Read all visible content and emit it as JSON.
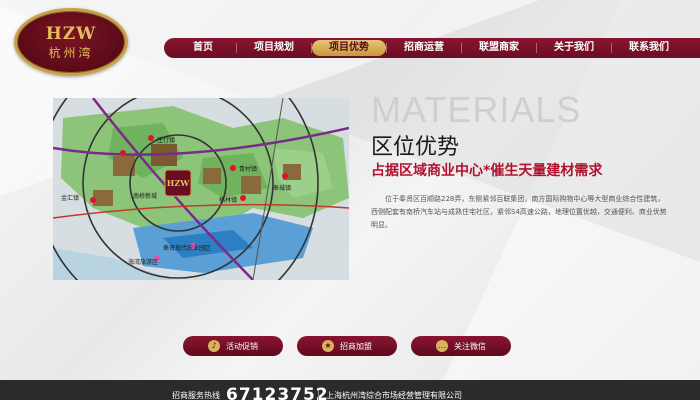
{
  "logo": {
    "mark": "HZW",
    "text": "杭州湾"
  },
  "nav": {
    "items": [
      {
        "label": "首页"
      },
      {
        "label": "项目规划"
      },
      {
        "label": "项目优势",
        "active": true
      },
      {
        "label": "招商运营"
      },
      {
        "label": "联盟商家"
      },
      {
        "label": "关于我们"
      },
      {
        "label": "联系我们"
      }
    ]
  },
  "map": {
    "labels": {
      "south_bridge": "南桥新城",
      "west_town": "金汇镇",
      "north_town": "奉城镇",
      "east_town": "青村镇",
      "south_town": "柘林镇",
      "mid_town": "庄行镇",
      "sw_town": "海湾旅游区",
      "south_area": "奉贤现代农业园区"
    }
  },
  "content": {
    "big_word": "MATERIALS",
    "title": "区位优势",
    "slogan": "占据区域商业中心*催生天量建材需求",
    "description": "位于奉贤区百顺路228弄，东侧紧邻百联集团，南方国际购物中心等大型商业综合性建筑，西侧配套有南桥汽车站与成熟住宅社区，紧邻S4高速公路，地理位置优越，交通便利、商业优势明显。"
  },
  "buttons": [
    {
      "label": "活动促销",
      "icon": "microphone-icon"
    },
    {
      "label": "招商加盟",
      "icon": "medal-icon"
    },
    {
      "label": "关注微信",
      "icon": "chat-icon"
    }
  ],
  "footer": {
    "hotline_label": "招商服务热线",
    "hotline_number": "67123752",
    "company": "上海杭州湾综合市场经营管理有限公司"
  },
  "colors": {
    "brand_red": "#6a0d23",
    "accent_gold": "#d9b35a",
    "slogan_red": "#b0112e",
    "footer_bg": "#2c2a2b"
  }
}
